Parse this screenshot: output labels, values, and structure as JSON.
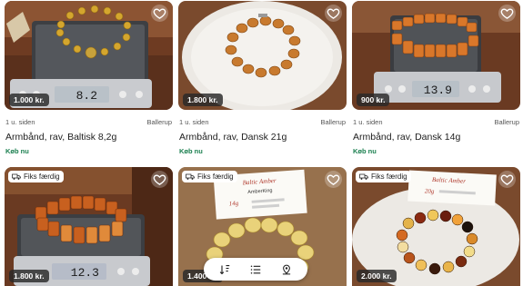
{
  "listings": [
    {
      "price": "1.000 kr.",
      "time": "1 u. siden",
      "location": "Ballerup",
      "title": "Armbånd, rav, Baltisk 8,2g",
      "buy_label": "Køb nu",
      "scale_reading": "8.2"
    },
    {
      "price": "1.800 kr.",
      "time": "1 u. siden",
      "location": "Ballerup",
      "title": "Armbånd, rav, Dansk 21g",
      "buy_label": "Køb nu"
    },
    {
      "price": "900 kr.",
      "time": "1 u. siden",
      "location": "Ballerup",
      "title": "Armbånd, rav, Dansk 14g",
      "buy_label": "Køb nu",
      "scale_reading": "13.9"
    },
    {
      "price": "1.800 kr.",
      "tag": "Fiks færdig",
      "scale_reading": "12.3"
    },
    {
      "price": "1.400 kr.",
      "tag": "Fiks færdig",
      "note_line1": "Baltic Amber",
      "note_line2": "AmberKing",
      "note_line3": "14g"
    },
    {
      "price": "2.000 kr.",
      "tag": "Fiks færdig",
      "note_line1": "Baltic Amber",
      "note_line3": "20g"
    }
  ],
  "icons": {
    "favorite": "heart-icon",
    "tag": "truck-icon",
    "sort": "sort-icon",
    "list": "list-icon",
    "location": "location-icon"
  },
  "colors": {
    "buy_green": "#1a7f4f",
    "amber": "#d9822b",
    "badge_bg": "#2a2a2a"
  }
}
